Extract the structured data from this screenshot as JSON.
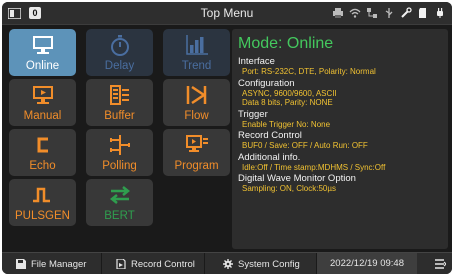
{
  "window": {
    "title": "Top Menu",
    "badge": "0"
  },
  "tiles": [
    {
      "label": "Online",
      "icon": "monitor-icon",
      "state": "selected"
    },
    {
      "label": "Delay",
      "icon": "stopwatch-icon",
      "state": "dim"
    },
    {
      "label": "Trend",
      "icon": "bar-chart-icon",
      "state": "dim"
    },
    {
      "label": "Manual",
      "icon": "manual-screen-icon",
      "state": "normal"
    },
    {
      "label": "Buffer",
      "icon": "buffer-icon",
      "state": "normal"
    },
    {
      "label": "Flow",
      "icon": "flow-icon",
      "state": "normal"
    },
    {
      "label": "Echo",
      "icon": "echo-icon",
      "state": "normal"
    },
    {
      "label": "Polling",
      "icon": "polling-icon",
      "state": "normal"
    },
    {
      "label": "Program",
      "icon": "program-icon",
      "state": "normal"
    },
    {
      "label": "PULSGEN",
      "icon": "pulse-icon",
      "state": "normal"
    },
    {
      "label": "BERT",
      "icon": "bert-arrows-icon",
      "state": "dim-green"
    }
  ],
  "info": {
    "mode": "Mode: Online",
    "sections": [
      {
        "heading": "Interface",
        "lines": [
          "Port: RS-232C, DTE, Polarity: Normal"
        ]
      },
      {
        "heading": "Configuration",
        "lines": [
          "ASYNC, 9600/9600, ASCII",
          "Data 8 bits, Parity: NONE"
        ]
      },
      {
        "heading": "Trigger",
        "lines": [
          "Enable Trigger No: None"
        ]
      },
      {
        "heading": "Record Control",
        "lines": [
          "BUF0 / Save: OFF / Auto Run: OFF"
        ]
      },
      {
        "heading": "Additional info.",
        "lines": [
          "Idle:Off / Time stamp:MDHMS / Sync:Off"
        ]
      },
      {
        "heading": "Digital Wave Monitor Option",
        "lines": [
          "Sampling: ON, Clock:50µs"
        ]
      }
    ]
  },
  "bottom": {
    "file_manager": "File Manager",
    "record_control": "Record Control",
    "system_config": "System Config",
    "datetime": "2022/12/19 09:48"
  },
  "colors": {
    "accent_orange": "#f18d2a",
    "mode_green": "#44c85e",
    "value_yellow": "#f1c232",
    "selected_tile": "#5d93b9"
  }
}
